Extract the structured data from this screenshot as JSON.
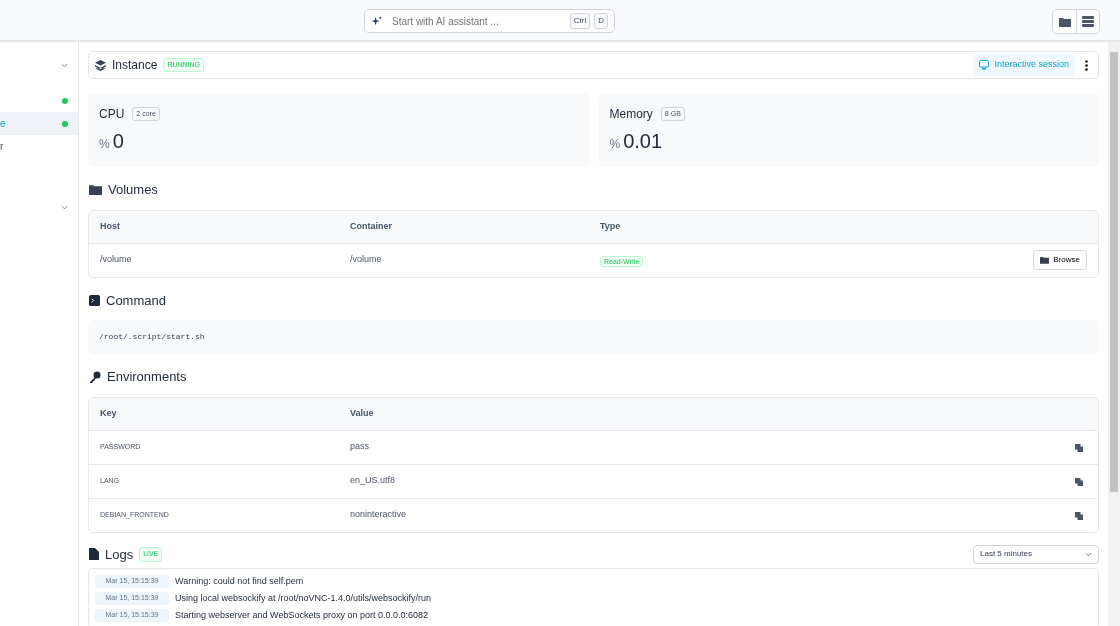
{
  "top_bar": {
    "search": {
      "placeholder": "Start with AI assistant ...",
      "shortcut": [
        "Ctrl",
        "D"
      ]
    }
  },
  "sidebar": {
    "items": [
      {
        "kind": "group"
      },
      {
        "kind": "link",
        "selected": false,
        "color": "#22c55e"
      },
      {
        "kind": "link",
        "label": "e",
        "selected": true,
        "color": "#22c55e"
      },
      {
        "kind": "link",
        "label": "r",
        "selected": false
      },
      {
        "kind": "group"
      }
    ]
  },
  "instance": {
    "title": "Instance",
    "status": "RUNNING",
    "action": "Interactive session"
  },
  "stats": [
    {
      "label": "CPU",
      "badge": "2 core",
      "unit": "%",
      "value": "0"
    },
    {
      "label": "Memory",
      "badge": "8 GB",
      "unit": "%",
      "value": "0.01"
    }
  ],
  "volumes": {
    "title": "Volumes",
    "columns": [
      "Host",
      "Container",
      "Type"
    ],
    "rows": [
      {
        "host": "/volume",
        "container": "/volume",
        "type": "Read-Write",
        "action": "Browse"
      }
    ]
  },
  "command": {
    "title": "Command",
    "text": "/root/.script/start.sh"
  },
  "environments": {
    "title": "Environments",
    "columns": [
      "Key",
      "Value"
    ],
    "rows": [
      {
        "key": "PASSWORD",
        "value": "pass"
      },
      {
        "key": "LANG",
        "value": "en_US.utf8"
      },
      {
        "key": "DEBIAN_FRONTEND",
        "value": "noninteractive"
      }
    ]
  },
  "logs": {
    "title": "Logs",
    "badge": "LIVE",
    "range": "Last 5 minutes",
    "entries": [
      {
        "time": "Mar 15, 15:15:39",
        "message": "Warning: could not find self.pem"
      },
      {
        "time": "Mar 15, 15:15:39",
        "message": "Using local websockify at /root/noVNC-1.4.0/utils/websockify/run"
      },
      {
        "time": "Mar 15, 15:15:39",
        "message": "Starting webserver and WebSockets proxy on port 0.0.0.0:6082"
      }
    ]
  }
}
